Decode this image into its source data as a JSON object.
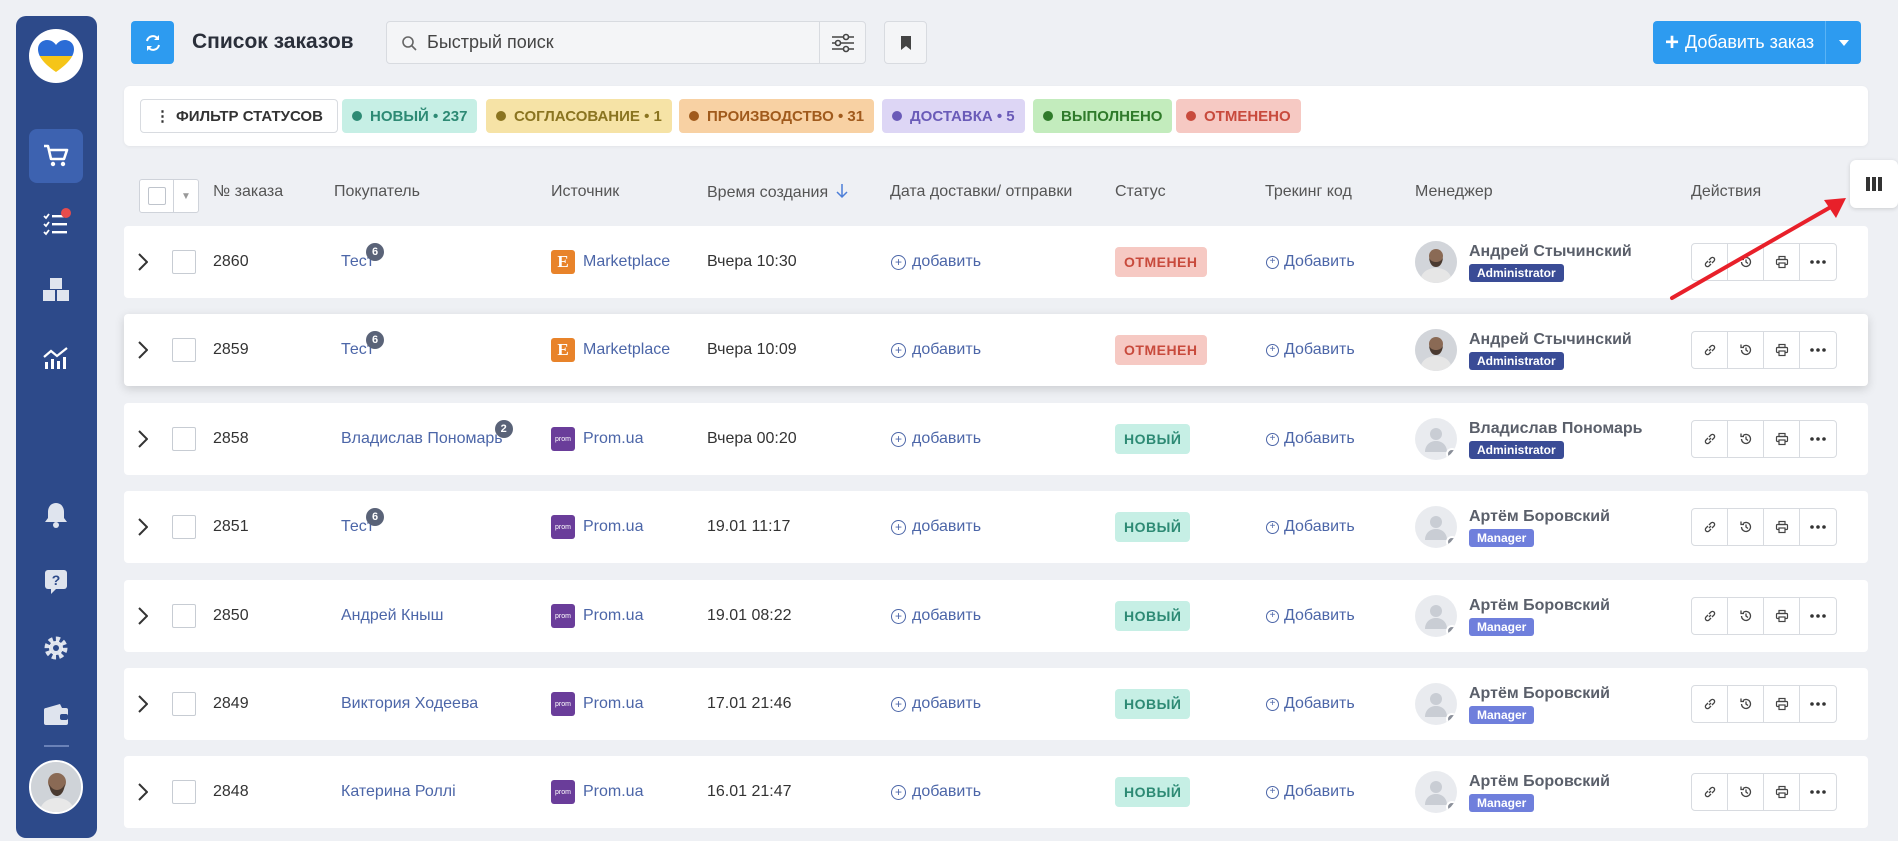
{
  "header": {
    "title": "Список заказов",
    "search_placeholder": "Быстрый поиск",
    "add_order_label": "Добавить заказ"
  },
  "status_filter": {
    "button_label": "ФИЛЬТР СТАТУСОВ",
    "chips": [
      {
        "label": "НОВЫЙ • 237",
        "bg": "#c6efe5",
        "fg": "#2d8a74",
        "dot": "#2d8a74"
      },
      {
        "label": "СОГЛАСОВАНИЕ • 1",
        "bg": "#f6e3a6",
        "fg": "#8a7420",
        "dot": "#8a7420"
      },
      {
        "label": "ПРОИЗВОДСТВО • 31",
        "bg": "#f8d1a3",
        "fg": "#a05a1c",
        "dot": "#a05a1c"
      },
      {
        "label": "ДОСТАВКА • 5",
        "bg": "#ddd6f5",
        "fg": "#6a5bb8",
        "dot": "#6a5bb8"
      },
      {
        "label": "ВЫПОЛНЕНО",
        "bg": "#c3ecbd",
        "fg": "#2f7a2a",
        "dot": "#2f7a2a"
      },
      {
        "label": "ОТМЕНЕНО",
        "bg": "#f6c9c3",
        "fg": "#c84a3c",
        "dot": "#c84a3c"
      }
    ]
  },
  "table": {
    "columns": [
      "№ заказа",
      "Покупатель",
      "Источник",
      "Время создания",
      "Дата доставки/ отправки",
      "Статус",
      "Трекинг код",
      "Менеджер",
      "Действия"
    ],
    "add_delivery_label": "добавить",
    "add_tracking_label": "Добавить",
    "rows": [
      {
        "id": "2860",
        "buyer": "Тест",
        "buyer_count": "6",
        "source": "Marketplace",
        "source_type": "etsy",
        "created": "Вчера 10:30",
        "status": "ОТМЕНЕН",
        "status_type": "cancel",
        "manager": "Андрей Стычинский",
        "role": "Administrator",
        "role_type": "admin",
        "avatar": "photo"
      },
      {
        "id": "2859",
        "buyer": "Тест",
        "buyer_count": "6",
        "source": "Marketplace",
        "source_type": "etsy",
        "created": "Вчера 10:09",
        "status": "ОТМЕНЕН",
        "status_type": "cancel",
        "manager": "Андрей Стычинский",
        "role": "Administrator",
        "role_type": "admin",
        "avatar": "photo"
      },
      {
        "id": "2858",
        "buyer": "Владислав Пономарь",
        "buyer_count": "2",
        "source": "Prom.ua",
        "source_type": "prom",
        "created": "Вчера 00:20",
        "status": "НОВЫЙ",
        "status_type": "new",
        "manager": "Владислав Пономарь",
        "role": "Administrator",
        "role_type": "admin",
        "avatar": "generic"
      },
      {
        "id": "2851",
        "buyer": "Тест",
        "buyer_count": "6",
        "source": "Prom.ua",
        "source_type": "prom",
        "created": "19.01 11:17",
        "status": "НОВЫЙ",
        "status_type": "new",
        "manager": "Артём Боровский",
        "role": "Manager",
        "role_type": "manager",
        "avatar": "generic"
      },
      {
        "id": "2850",
        "buyer": "Андрей Кныш",
        "buyer_count": "",
        "source": "Prom.ua",
        "source_type": "prom",
        "created": "19.01 08:22",
        "status": "НОВЫЙ",
        "status_type": "new",
        "manager": "Артём Боровский",
        "role": "Manager",
        "role_type": "manager",
        "avatar": "generic"
      },
      {
        "id": "2849",
        "buyer": "Виктория Ходеева",
        "buyer_count": "",
        "source": "Prom.ua",
        "source_type": "prom",
        "created": "17.01 21:46",
        "status": "НОВЫЙ",
        "status_type": "new",
        "manager": "Артём Боровский",
        "role": "Manager",
        "role_type": "manager",
        "avatar": "generic"
      },
      {
        "id": "2848",
        "buyer": "Катерина Роллі",
        "buyer_count": "",
        "source": "Prom.ua",
        "source_type": "prom",
        "created": "16.01 21:47",
        "status": "НОВЫЙ",
        "status_type": "new",
        "manager": "Артём Боровский",
        "role": "Manager",
        "role_type": "manager",
        "avatar": "generic"
      }
    ]
  },
  "colors": {
    "accent": "#2d9bf0",
    "sidebar": "#2d4a8a"
  }
}
